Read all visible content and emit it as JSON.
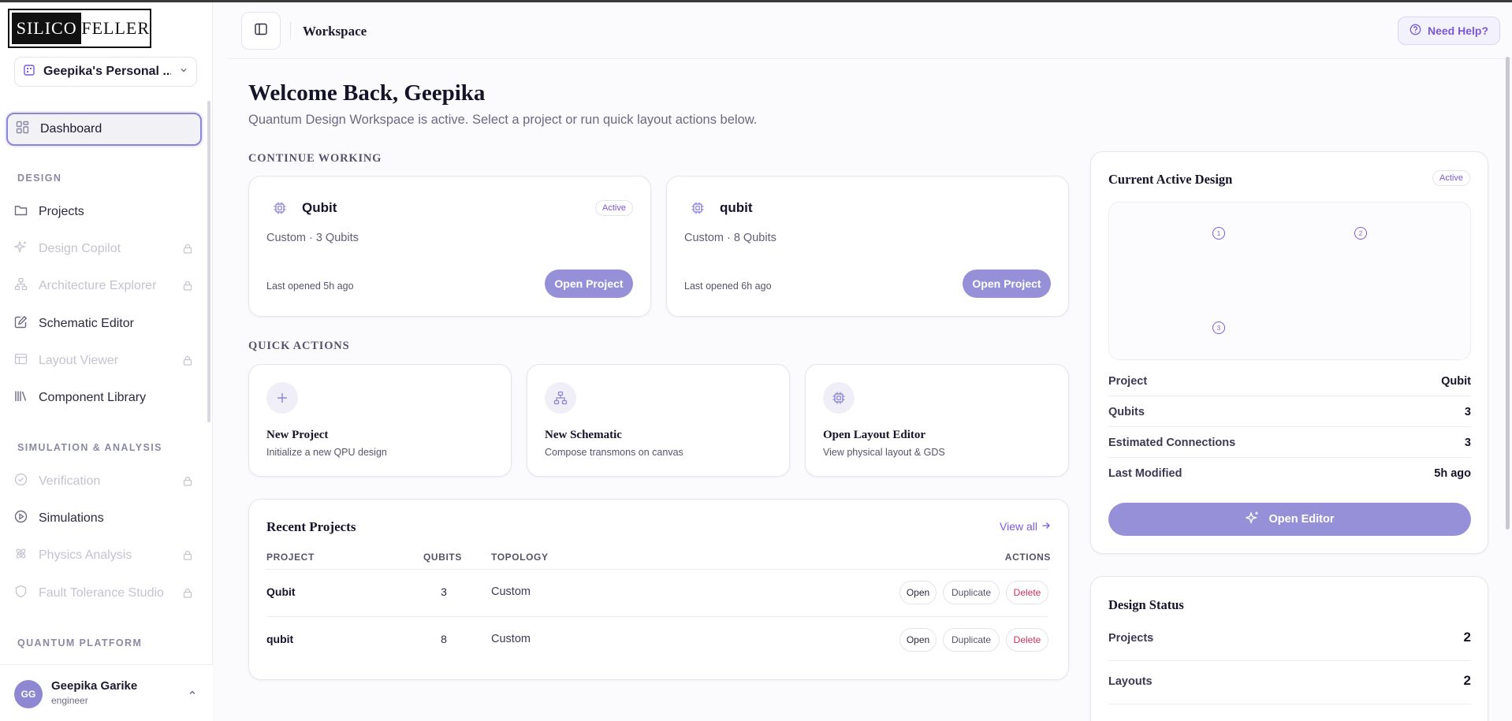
{
  "brand": {
    "left": "SILICO",
    "right": "FELLER"
  },
  "org": {
    "label": "Geepika's Personal ..."
  },
  "nav": {
    "dashboard": "Dashboard",
    "design_section": "DESIGN",
    "design_items": [
      {
        "label": "Projects",
        "locked": false
      },
      {
        "label": "Design Copilot",
        "locked": true
      },
      {
        "label": "Architecture Explorer",
        "locked": true
      },
      {
        "label": "Schematic Editor",
        "locked": false
      },
      {
        "label": "Layout Viewer",
        "locked": true
      },
      {
        "label": "Component Library",
        "locked": false
      }
    ],
    "sim_section": "SIMULATION & ANALYSIS",
    "sim_items": [
      {
        "label": "Verification",
        "locked": true
      },
      {
        "label": "Simulations",
        "locked": false
      },
      {
        "label": "Physics Analysis",
        "locked": true
      },
      {
        "label": "Fault Tolerance Studio",
        "locked": true
      }
    ],
    "platform_section": "QUANTUM PLATFORM"
  },
  "user": {
    "initials": "GG",
    "name": "Geepika Garike",
    "role": "engineer"
  },
  "header": {
    "title": "Workspace",
    "help": "Need Help?"
  },
  "main": {
    "welcome": "Welcome Back, Geepika",
    "subtitle": "Quantum Design Workspace is active. Select a project or run quick layout actions below.",
    "continue_label": "CONTINUE WORKING",
    "projects": [
      {
        "name": "Qubit",
        "badge": "Active",
        "meta": "Custom · 3 Qubits",
        "opened": "Last opened 5h ago",
        "button": "Open Project"
      },
      {
        "name": "qubit",
        "badge": "",
        "meta": "Custom · 8 Qubits",
        "opened": "Last opened 6h ago",
        "button": "Open Project"
      }
    ],
    "quick_label": "QUICK ACTIONS",
    "quick_actions": [
      {
        "title": "New Project",
        "desc": "Initialize a new QPU design",
        "icon": "plus-icon"
      },
      {
        "title": "New Schematic",
        "desc": "Compose transmons on canvas",
        "icon": "network-icon"
      },
      {
        "title": "Open Layout Editor",
        "desc": "View physical layout & GDS",
        "icon": "chip-icon"
      }
    ],
    "recent": {
      "title": "Recent Projects",
      "view_all": "View all",
      "headers": {
        "project": "PROJECT",
        "qubits": "QUBITS",
        "topology": "TOPOLOGY",
        "actions": "ACTIONS"
      },
      "rows": [
        {
          "name": "Qubit",
          "qubits": "3",
          "topology": "Custom"
        },
        {
          "name": "qubit",
          "qubits": "8",
          "topology": "Custom"
        }
      ],
      "actions": {
        "open": "Open",
        "duplicate": "Duplicate",
        "delete": "Delete"
      }
    }
  },
  "active_design": {
    "title": "Current Active Design",
    "badge": "Active",
    "nodes": [
      "1",
      "2",
      "3"
    ],
    "details": [
      {
        "key": "Project",
        "value": "Qubit"
      },
      {
        "key": "Qubits",
        "value": "3"
      },
      {
        "key": "Estimated Connections",
        "value": "3"
      },
      {
        "key": "Last Modified",
        "value": "5h ago"
      }
    ],
    "button": "Open Editor"
  },
  "design_status": {
    "title": "Design Status",
    "items": [
      {
        "key": "Projects",
        "value": "2"
      },
      {
        "key": "Layouts",
        "value": "2"
      }
    ]
  },
  "colors": {
    "accent": "#9690d8",
    "accent_text": "#7b59d6",
    "danger": "#d3325a"
  }
}
